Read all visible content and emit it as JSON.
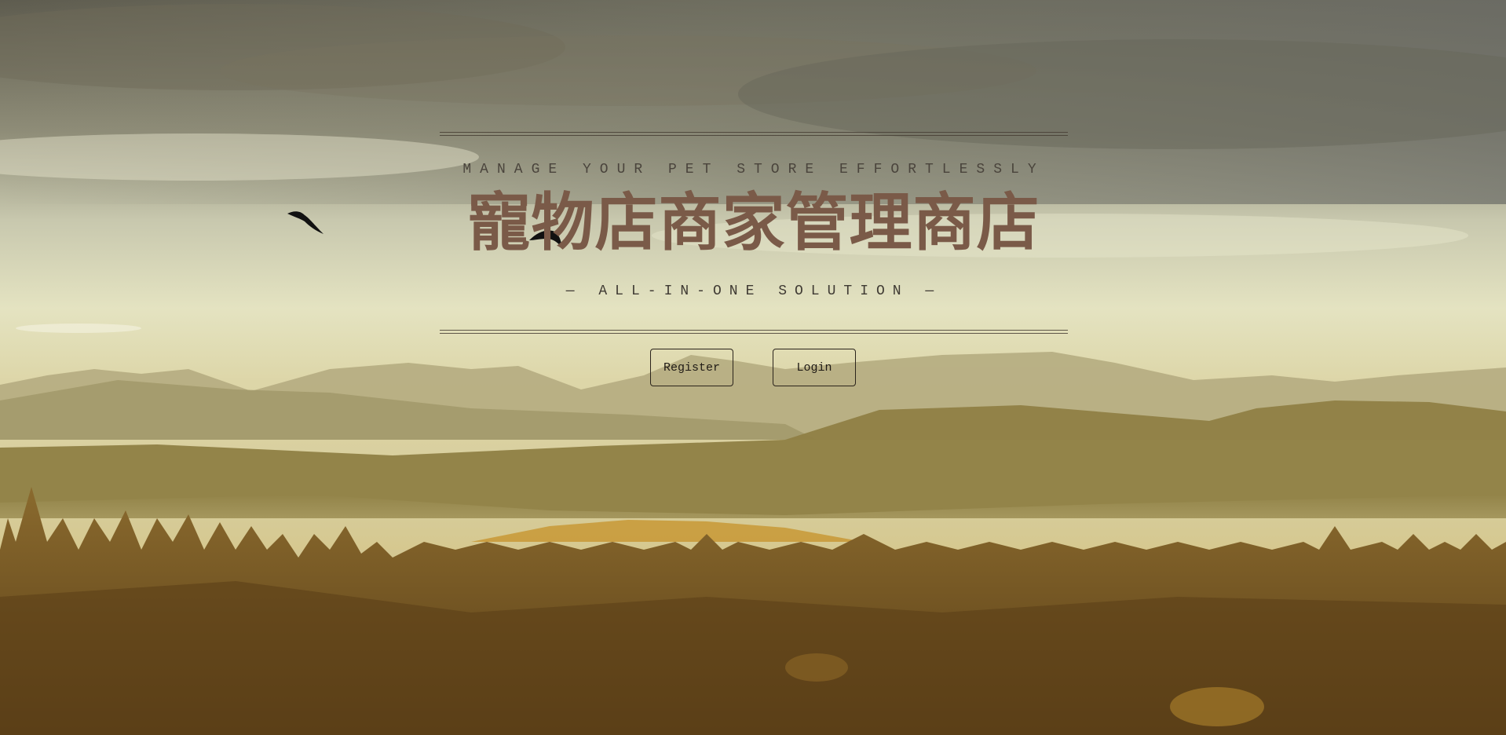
{
  "hero": {
    "tagline": "MANAGE YOUR PET STORE EFFORTLESSLY",
    "title": "寵物店商家管理商店",
    "subtitle": "— ALL-IN-ONE SOLUTION —"
  },
  "actions": {
    "register_label": "Register",
    "login_label": "Login"
  },
  "background": {
    "description_icon": "landscape-background",
    "sky_color": "#c9c7a6",
    "forest_color": "#6b4d1e",
    "title_color": "#7a5a48"
  }
}
